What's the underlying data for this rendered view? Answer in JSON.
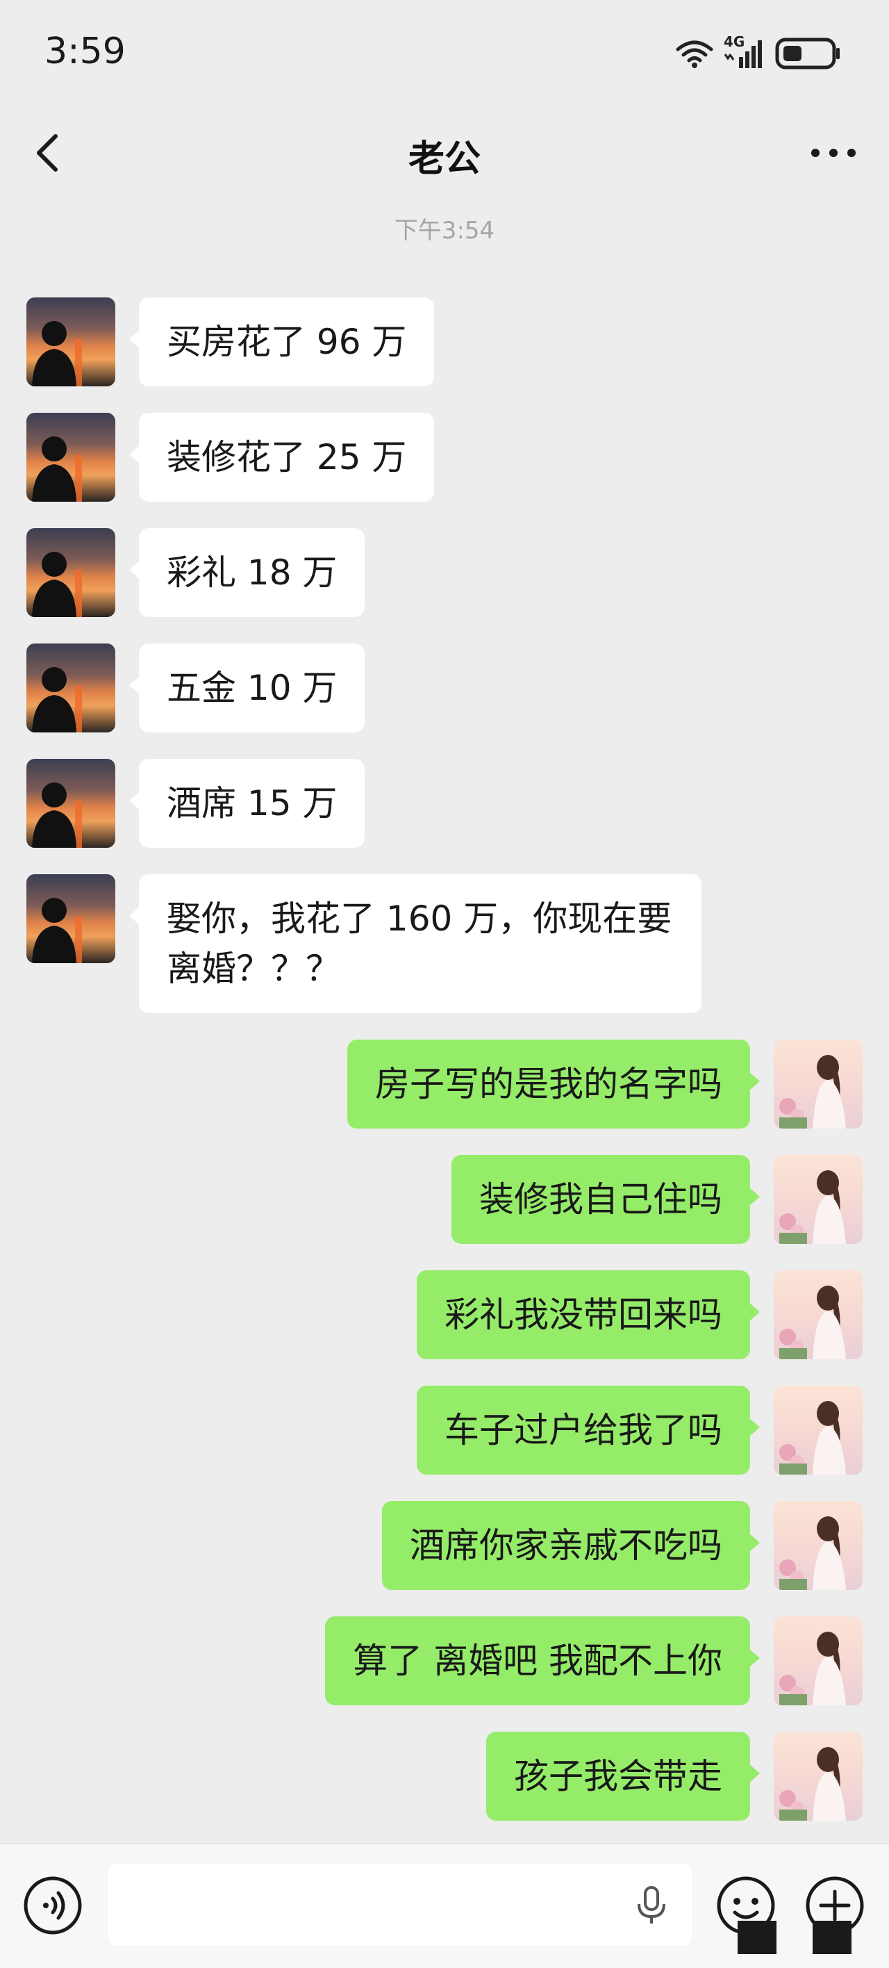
{
  "status_bar": {
    "time": "3:59",
    "network": "4G"
  },
  "header": {
    "title": "老公"
  },
  "timestamp": "下午3:54",
  "messages": [
    {
      "side": "in",
      "text": "买房花了 96 万"
    },
    {
      "side": "in",
      "text": "装修花了 25 万"
    },
    {
      "side": "in",
      "text": "彩礼 18 万"
    },
    {
      "side": "in",
      "text": "五金 10 万"
    },
    {
      "side": "in",
      "text": "酒席 15 万"
    },
    {
      "side": "in",
      "text": "娶你，我花了 160 万，你现在要离婚？？？"
    },
    {
      "side": "out",
      "text": "房子写的是我的名字吗"
    },
    {
      "side": "out",
      "text": "装修我自己住吗"
    },
    {
      "side": "out",
      "text": "彩礼我没带回来吗"
    },
    {
      "side": "out",
      "text": "车子过户给我了吗"
    },
    {
      "side": "out",
      "text": "酒席你家亲戚不吃吗"
    },
    {
      "side": "out",
      "text": "算了 离婚吧 我配不上你"
    },
    {
      "side": "out",
      "text": "孩子我会带走"
    }
  ],
  "icons": {
    "back": "chevron-left-icon",
    "more": "more-dots-icon",
    "voice": "voice-icon",
    "mic": "microphone-icon",
    "emoji": "emoji-icon",
    "plus": "plus-icon"
  },
  "colors": {
    "background": "#ededed",
    "incoming_bubble": "#ffffff",
    "outgoing_bubble": "#95ec69",
    "timestamp": "#a6a6a6"
  }
}
